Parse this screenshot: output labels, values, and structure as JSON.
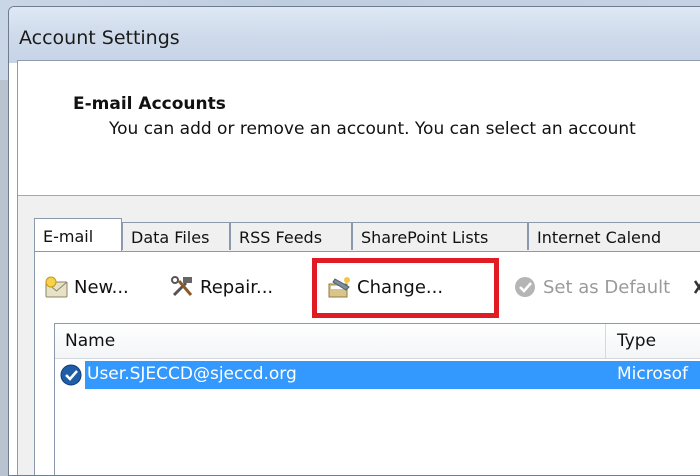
{
  "window": {
    "title": "Account Settings"
  },
  "header": {
    "title": "E-mail Accounts",
    "description": "You can add or remove an account. You can select an account"
  },
  "tabs": [
    {
      "label": "E-mail",
      "active": true
    },
    {
      "label": "Data Files",
      "active": false
    },
    {
      "label": "RSS Feeds",
      "active": false
    },
    {
      "label": "SharePoint Lists",
      "active": false
    },
    {
      "label": "Internet Calend",
      "active": false
    }
  ],
  "toolbar": {
    "new_label": "New...",
    "repair_label": "Repair...",
    "change_label": "Change...",
    "default_label": "Set as Default",
    "remove_label": "X"
  },
  "list": {
    "columns": [
      "Name",
      "Type"
    ],
    "rows": [
      {
        "name": "User.SJECCD@sjeccd.org",
        "type": "Microsof",
        "selected": true,
        "icon": "default-account-check-icon"
      }
    ]
  },
  "colors": {
    "highlight": "#e01b24",
    "selection": "#3399ff"
  }
}
